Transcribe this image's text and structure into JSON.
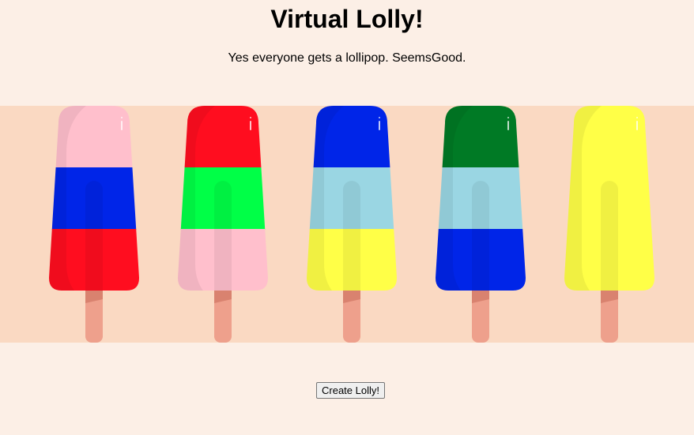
{
  "header": {
    "title": "Virtual Lolly!",
    "subtitle": "Yes everyone gets a lollipop. SeemsGood."
  },
  "colors": {
    "page_background": "#fcefe6",
    "band_background": "#fad9c2",
    "stick": "#eea08c",
    "stick_shadow": "#d9826f"
  },
  "lollies": [
    {
      "name": "pink-blue-red",
      "top": "#ffbfcc",
      "middle": "#0025e8",
      "bottom": "#ff0d1f"
    },
    {
      "name": "red-green-pink",
      "top": "#ff0d1f",
      "middle": "#00ff47",
      "bottom": "#ffbfcc"
    },
    {
      "name": "blue-lightblue-yellow",
      "top": "#0025e8",
      "middle": "#9ad6e3",
      "bottom": "#ffff47"
    },
    {
      "name": "green-lightblue-blue",
      "top": "#007a25",
      "middle": "#9ad6e3",
      "bottom": "#0025e8"
    },
    {
      "name": "yellow-yellow-yellow",
      "top": "#ffff47",
      "middle": "#ffff47",
      "bottom": "#ffff47"
    }
  ],
  "actions": {
    "create_label": "Create Lolly!"
  }
}
